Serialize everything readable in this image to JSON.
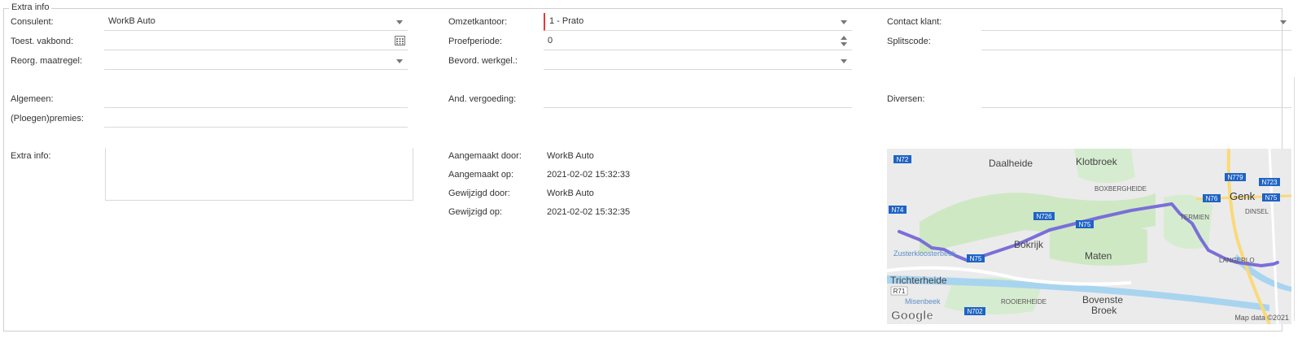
{
  "section": {
    "legend": "Extra info"
  },
  "fields": {
    "consulent": {
      "label": "Consulent:",
      "value": "WorkB Auto"
    },
    "omzetkantoor": {
      "label": "Omzetkantoor:",
      "value": "1 - Prato"
    },
    "contact_klant": {
      "label": "Contact klant:",
      "value": ""
    },
    "toest_vakbond": {
      "label": "Toest. vakbond:",
      "value": ""
    },
    "proefperiode": {
      "label": "Proefperiode:",
      "value": "0"
    },
    "splitscode": {
      "label": "Splitscode:",
      "value": ""
    },
    "reorg_maatregel": {
      "label": "Reorg. maatregel:",
      "value": ""
    },
    "bevord_werkgel": {
      "label": "Bevord. werkgel.:",
      "value": ""
    },
    "algemeen": {
      "label": "Algemeen:",
      "value": ""
    },
    "and_vergoeding": {
      "label": "And. vergoeding:",
      "value": ""
    },
    "diversen": {
      "label": "Diversen:",
      "value": ""
    },
    "ploegenpremies": {
      "label": "(Ploegen)premies:",
      "value": ""
    },
    "extra_info": {
      "label": "Extra info:",
      "value": ""
    }
  },
  "audit": {
    "aangemaakt_door": {
      "label": "Aangemaakt door:",
      "value": "WorkB Auto"
    },
    "aangemaakt_op": {
      "label": "Aangemaakt op:",
      "value": "2021-02-02 15:32:33"
    },
    "gewijzigd_door": {
      "label": "Gewijzigd door:",
      "value": "WorkB Auto"
    },
    "gewijzigd_op": {
      "label": "Gewijzigd op:",
      "value": "2021-02-02 15:32:35"
    }
  },
  "map": {
    "places": {
      "daalheide": "Daalheide",
      "klotbroek": "Klotbroek",
      "boxbergheide": "BOXBERGHEIDE",
      "genk": "Genk",
      "dinsel": "DINSEL",
      "termien": "TERMIEN",
      "bokrijk": "Bokrijk",
      "maten": "Maten",
      "langerlo": "LANGERLO",
      "zusterkloosterbeek": "Zusterkloosterbeek",
      "trichterheide": "Trichterheide",
      "misenbeek": "Misenbeek",
      "rooierheide": "ROOIERHEIDE",
      "bovenste_broek_1": "Bovenste",
      "bovenste_broek_2": "Broek"
    },
    "roads": {
      "n72": "N72",
      "n74": "N74",
      "n726": "N726",
      "n75a": "N75",
      "n75b": "N75",
      "n75c": "N75",
      "n76": "N76",
      "n779": "N779",
      "n723": "N723",
      "r71": "R71",
      "n702": "N702"
    },
    "logo": "Google",
    "attribution": "Map data ©2021",
    "colors": {
      "route": "#7a6fd8",
      "water": "#a8d4f0",
      "green": "#cfe8c4",
      "land": "#ebebeb",
      "shield": "#1f63c4",
      "major_road": "#fad97a"
    }
  }
}
